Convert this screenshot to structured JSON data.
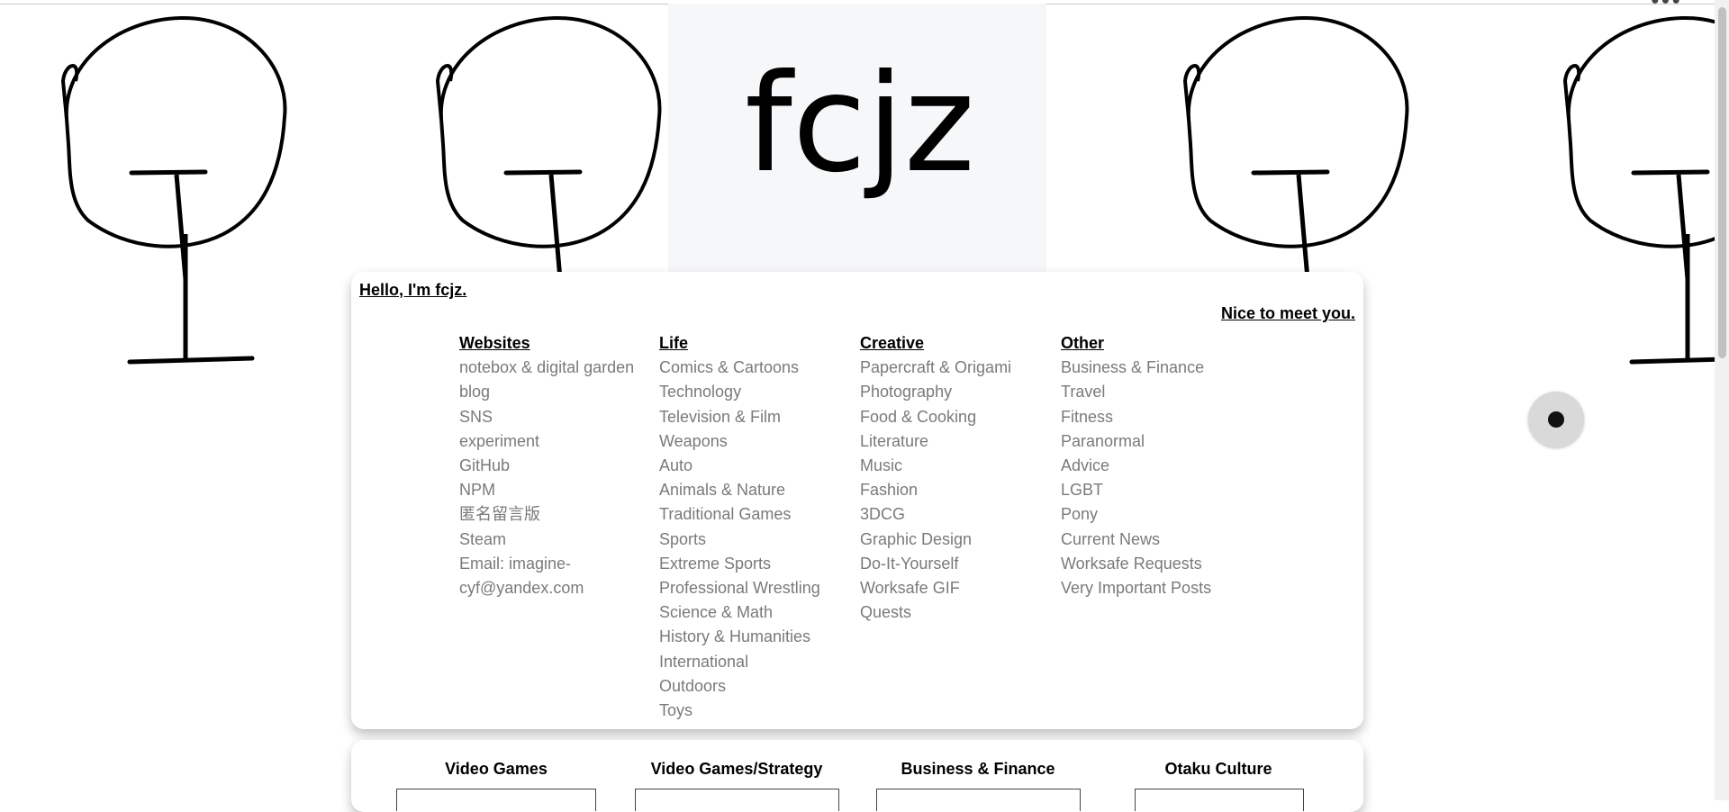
{
  "header": {
    "logo_text": "fcjz",
    "top_menu_icon": "ellipsis-icon"
  },
  "intro": {
    "greeting": "Hello, I'm fcjz.",
    "nice": "Nice to meet you."
  },
  "columns": [
    {
      "title": "Websites",
      "items": [
        "notebox & digital garden",
        "blog",
        "SNS",
        "experiment",
        "GitHub",
        "NPM",
        "匿名留言版",
        "Steam",
        "Email: imagine-",
        "cyf@yandex.com"
      ]
    },
    {
      "title": "Life",
      "items": [
        "Comics & Cartoons",
        "Technology",
        "Television & Film",
        "Weapons",
        "Auto",
        "Animals & Nature",
        "Traditional Games",
        "Sports",
        "Extreme Sports",
        "Professional Wrestling",
        "Science & Math",
        "History & Humanities",
        "International",
        "Outdoors",
        "Toys"
      ]
    },
    {
      "title": "Creative",
      "items": [
        "Papercraft & Origami",
        "Photography",
        "Food & Cooking",
        "Literature",
        "Music",
        "Fashion",
        "3DCG",
        "Graphic Design",
        "Do-It-Yourself",
        "Worksafe GIF",
        "Quests"
      ]
    },
    {
      "title": "Other",
      "items": [
        "Business & Finance",
        "Travel",
        "Fitness",
        "Paranormal",
        "Advice",
        "LGBT",
        "Pony",
        "Current News",
        "Worksafe Requests",
        "Very Important Posts"
      ]
    }
  ],
  "categories": [
    "Video Games",
    "Video Games/Strategy",
    "Business & Finance",
    "Otaku Culture"
  ],
  "floating_button": {
    "icon": "record-dot-icon"
  }
}
